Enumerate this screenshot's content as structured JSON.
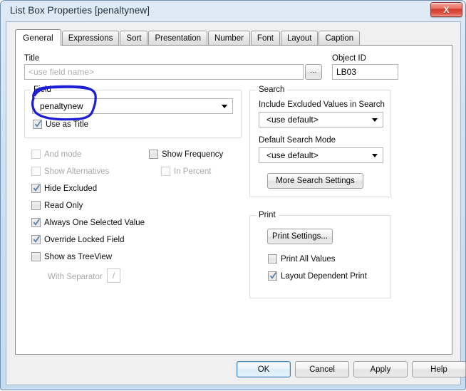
{
  "window": {
    "title": "List Box Properties [penaltynew]",
    "close_label": "X",
    "accent_blue": "#3c7fb1",
    "annotation_color": "#1d1dd6"
  },
  "tabs": [
    {
      "label": "General",
      "active": true
    },
    {
      "label": "Expressions",
      "active": false
    },
    {
      "label": "Sort",
      "active": false
    },
    {
      "label": "Presentation",
      "active": false
    },
    {
      "label": "Number",
      "active": false
    },
    {
      "label": "Font",
      "active": false
    },
    {
      "label": "Layout",
      "active": false
    },
    {
      "label": "Caption",
      "active": false
    }
  ],
  "general": {
    "title_label": "Title",
    "title_value": "<use field name>",
    "title_browse_label": "...",
    "object_id_label": "Object ID",
    "object_id_value": "LB03",
    "field_group_label": "Field",
    "field_value": "penaltynew",
    "use_as_title": {
      "label": "Use as Title",
      "checked": true,
      "enabled": true
    },
    "options": [
      {
        "label": "And mode",
        "checked": false,
        "enabled": false
      },
      {
        "label": "Show Alternatives",
        "checked": false,
        "enabled": false
      },
      {
        "label": "Hide Excluded",
        "checked": true,
        "enabled": true
      },
      {
        "label": "Read Only",
        "checked": false,
        "enabled": true
      },
      {
        "label": "Always One Selected Value",
        "checked": true,
        "enabled": true
      },
      {
        "label": "Override Locked Field",
        "checked": true,
        "enabled": true
      },
      {
        "label": "Show as TreeView",
        "checked": false,
        "enabled": true
      }
    ],
    "with_separator": {
      "label": "With Separator",
      "value": "/",
      "enabled": false
    },
    "frequency": [
      {
        "label": "Show Frequency",
        "checked": false,
        "enabled": true
      },
      {
        "label": "In Percent",
        "checked": false,
        "enabled": false
      }
    ]
  },
  "search": {
    "group_label": "Search",
    "include_excluded_label": "Include Excluded Values in Search",
    "include_excluded_value": "<use default>",
    "default_search_mode_label": "Default Search Mode",
    "default_search_mode_value": "<use default>",
    "more_settings_label": "More Search Settings"
  },
  "print": {
    "group_label": "Print",
    "print_settings_label": "Print Settings...",
    "options": [
      {
        "label": "Print All Values",
        "checked": false,
        "enabled": true
      },
      {
        "label": "Layout Dependent Print",
        "checked": true,
        "enabled": true
      }
    ]
  },
  "buttons": {
    "ok": "OK",
    "cancel": "Cancel",
    "apply": "Apply",
    "help": "Help"
  }
}
